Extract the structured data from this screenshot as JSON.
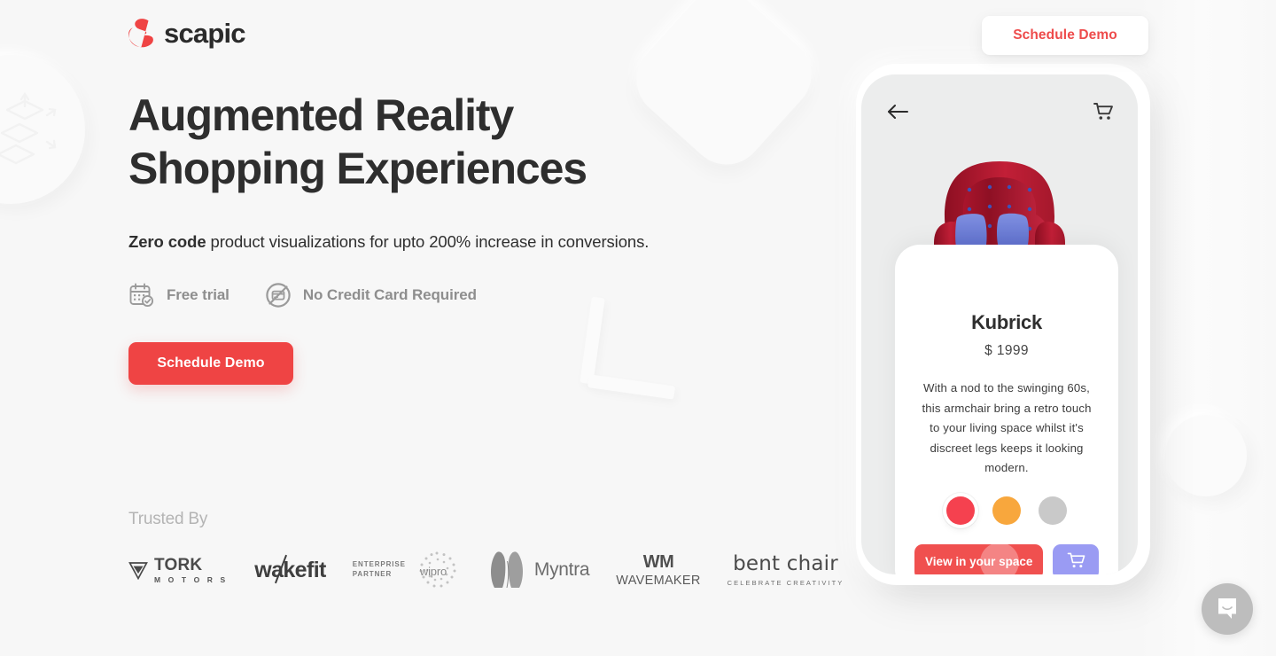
{
  "brand": {
    "name": "scapic",
    "logo_icon": "scapic-pebble-icon",
    "accent_color": "#ef4444",
    "text_color": "#2e2e2e",
    "background_color": "#f7f7f7"
  },
  "header": {
    "cta_label": "Schedule Demo"
  },
  "hero": {
    "title": "Augmented Reality\nShopping Experiences",
    "subtitle_bold": "Zero code",
    "subtitle_rest": " product visualizations for upto 200% increase in conversions.",
    "features": [
      {
        "icon": "calendar-check-icon",
        "label": "Free trial"
      },
      {
        "icon": "no-credit-card-icon",
        "label": "No Credit Card Required"
      }
    ],
    "cta_label": "Schedule Demo"
  },
  "trusted": {
    "label": "Trusted By",
    "logos": [
      {
        "icon": "tork-motors-logo",
        "name": "TORK",
        "sub": "M O T O R S"
      },
      {
        "icon": "wakefit-logo",
        "name": "wakefit",
        "sub": ""
      },
      {
        "icon": "wipro-logo",
        "name": "wipro",
        "sub": "ENTERPRISE PARTNER",
        "sub_line1": "ENTERPRISE",
        "sub_line2": "PARTNER"
      },
      {
        "icon": "myntra-logo",
        "name": "Myntra",
        "sub": ""
      },
      {
        "icon": "wavemaker-logo",
        "name": "WM",
        "sub": "WAVEMAKER"
      },
      {
        "icon": "bent-chair-logo",
        "name": "bent chair",
        "sub": "CELEBRATE CREATIVITY"
      }
    ]
  },
  "phone": {
    "back_icon": "back-arrow-icon",
    "cart_icon": "cart-icon",
    "product": {
      "image_alt": "red-wingback-armchair",
      "name": "Kubrick",
      "price": "$ 1999",
      "description": "With a nod to the swinging 60s, this armchair bring a retro touch to your living space whilst it's discreet legs keeps it looking modern.",
      "colors": [
        {
          "name": "red",
          "hex": "#f5414f",
          "selected": true
        },
        {
          "name": "orange",
          "hex": "#f8a73d",
          "selected": false
        },
        {
          "name": "grey",
          "hex": "#c9c9c9",
          "selected": false
        }
      ],
      "view_button_label": "View in your space",
      "cart_button_icon": "cart-icon"
    }
  },
  "chat_widget": {
    "icon": "intercom-message-icon"
  }
}
